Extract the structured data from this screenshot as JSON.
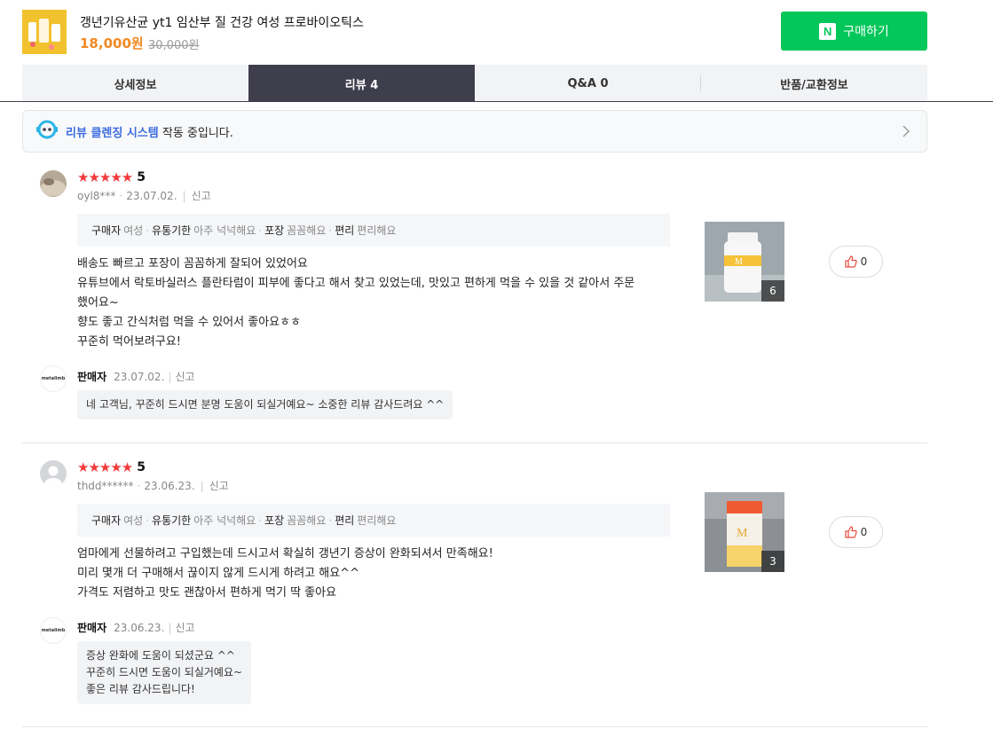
{
  "product": {
    "title": "갱년기유산균 yt1 임산부 질 건강 여성 프로바이오틱스",
    "price": "18,000원",
    "original_price": "30,000원",
    "buy_icon": "N",
    "buy_label": "구매하기"
  },
  "tabs": [
    {
      "label": "상세정보"
    },
    {
      "label": "리뷰 4"
    },
    {
      "label": "Q&A 0"
    },
    {
      "label": "반품/교환정보"
    }
  ],
  "cleaning_banner": {
    "highlight": "리뷰 클렌징 시스템",
    "text": " 작동 중입니다."
  },
  "reviews": [
    {
      "stars": "★★★★★",
      "score": "5",
      "user": "oyl8***",
      "date": "23.07.02.",
      "report": "신고",
      "attributes": {
        "buyer_k": "구매자",
        "buyer_v": "여성",
        "expiry_k": "유통기한",
        "expiry_v": "아주 넉넉해요",
        "pack_k": "포장",
        "pack_v": "꼼꼼해요",
        "conv_k": "편리",
        "conv_v": "편리해요"
      },
      "lines": [
        "배송도 빠르고 포장이 꼼꼼하게 잘되어 있었어요",
        "유튜브에서 락토바실러스 플란타럼이 피부에 좋다고 해서 찾고 있었는데, 맛있고 편하게 먹을 수 있을 것 같아서 주문",
        "했어요~",
        "향도 좋고 간식처럼 먹을 수 있어서 좋아요ㅎㅎ",
        "꾸준히 먹어보려구요!"
      ],
      "photo_count": "6",
      "likes": "0",
      "seller_logo": "metalimb",
      "seller_name": "판매자",
      "seller_date": "23.07.02.",
      "seller_report": "신고",
      "reply_lines": [
        "네 고객님, 꾸준히 드시면 분명 도움이 되실거예요~ 소중한 리뷰 감사드려요 ^^"
      ]
    },
    {
      "stars": "★★★★★",
      "score": "5",
      "user": "thdd******",
      "date": "23.06.23.",
      "report": "신고",
      "attributes": {
        "buyer_k": "구매자",
        "buyer_v": "여성",
        "expiry_k": "유통기한",
        "expiry_v": "아주 넉넉해요",
        "pack_k": "포장",
        "pack_v": "꼼꼼해요",
        "conv_k": "편리",
        "conv_v": "편리해요"
      },
      "lines": [
        "엄마에게 선물하려고 구입했는데 드시고서 확실히 갱년기 증상이 완화되셔서 만족해요!",
        "미리 몇개 더 구매해서 끊이지 않게 드시게 하려고 해요^^",
        "가격도 저렴하고 맛도 괜찮아서 편하게 먹기 딱 좋아요"
      ],
      "photo_count": "3",
      "likes": "0",
      "seller_logo": "metalimb",
      "seller_name": "판매자",
      "seller_date": "23.06.23.",
      "seller_report": "신고",
      "reply_lines": [
        "증상 완화에 도움이 되셨군요 ^^",
        "꾸준히 드시면 도움이 되실거예요~",
        "좋은 리뷰 감사드립니다!"
      ]
    }
  ],
  "colors": {
    "accent_green": "#03c75a",
    "price_orange": "#f08a24",
    "star_red": "#f1393b",
    "active_tab": "#3f3e4d",
    "link_blue": "#3d6ce0"
  }
}
